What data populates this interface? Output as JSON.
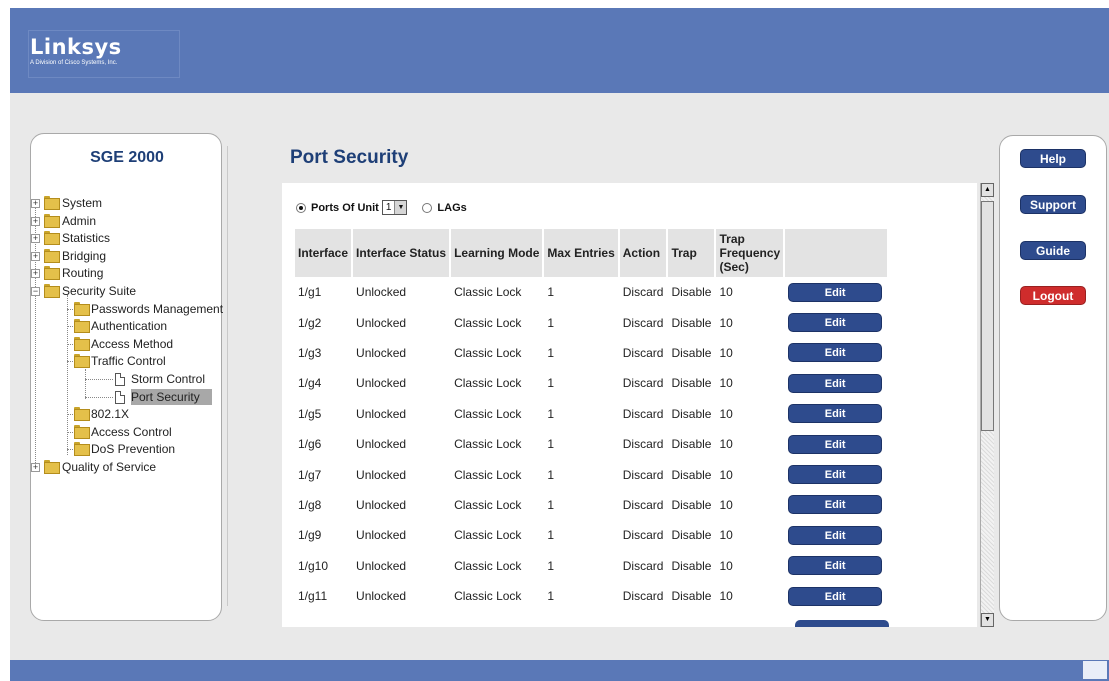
{
  "brand": {
    "name": "Linksys",
    "tagline": "A Division of Cisco Systems, Inc."
  },
  "panel": {
    "title": "SGE 2000"
  },
  "tree": {
    "system": "System",
    "admin": "Admin",
    "statistics": "Statistics",
    "bridging": "Bridging",
    "routing": "Routing",
    "security_suite": "Security Suite",
    "passwords": "Passwords Management",
    "authentication": "Authentication",
    "access_method": "Access Method",
    "traffic_control": "Traffic Control",
    "storm_control": "Storm Control",
    "port_security": "Port Security",
    "dot1x": "802.1X",
    "access_control": "Access Control",
    "dos": "DoS Prevention",
    "qos": "Quality of Service"
  },
  "page": {
    "title": "Port Security"
  },
  "filter": {
    "ports_label": "Ports",
    "of_unit_label": "Of Unit",
    "unit_value": "1",
    "lags_label": "LAGs",
    "selected": "ports"
  },
  "table": {
    "headers": [
      "Interface",
      "Interface Status",
      "Learning Mode",
      "Max Entries",
      "Action",
      "Trap",
      "Trap Frequency (Sec)"
    ],
    "rows": [
      [
        "1/g1",
        "Unlocked",
        "Classic Lock",
        "1",
        "Discard",
        "Disable",
        "10"
      ],
      [
        "1/g2",
        "Unlocked",
        "Classic Lock",
        "1",
        "Discard",
        "Disable",
        "10"
      ],
      [
        "1/g3",
        "Unlocked",
        "Classic Lock",
        "1",
        "Discard",
        "Disable",
        "10"
      ],
      [
        "1/g4",
        "Unlocked",
        "Classic Lock",
        "1",
        "Discard",
        "Disable",
        "10"
      ],
      [
        "1/g5",
        "Unlocked",
        "Classic Lock",
        "1",
        "Discard",
        "Disable",
        "10"
      ],
      [
        "1/g6",
        "Unlocked",
        "Classic Lock",
        "1",
        "Discard",
        "Disable",
        "10"
      ],
      [
        "1/g7",
        "Unlocked",
        "Classic Lock",
        "1",
        "Discard",
        "Disable",
        "10"
      ],
      [
        "1/g8",
        "Unlocked",
        "Classic Lock",
        "1",
        "Discard",
        "Disable",
        "10"
      ],
      [
        "1/g9",
        "Unlocked",
        "Classic Lock",
        "1",
        "Discard",
        "Disable",
        "10"
      ],
      [
        "1/g10",
        "Unlocked",
        "Classic Lock",
        "1",
        "Discard",
        "Disable",
        "10"
      ],
      [
        "1/g11",
        "Unlocked",
        "Classic Lock",
        "1",
        "Discard",
        "Disable",
        "10"
      ]
    ],
    "edit_label": "Edit"
  },
  "side_buttons": {
    "help": "Help",
    "support": "Support",
    "guide": "Guide",
    "logout": "Logout"
  },
  "colors": {
    "header": "#5a78b7",
    "button": "#2e4b8d",
    "logout": "#cf2c2c",
    "title": "#1e3f77"
  }
}
